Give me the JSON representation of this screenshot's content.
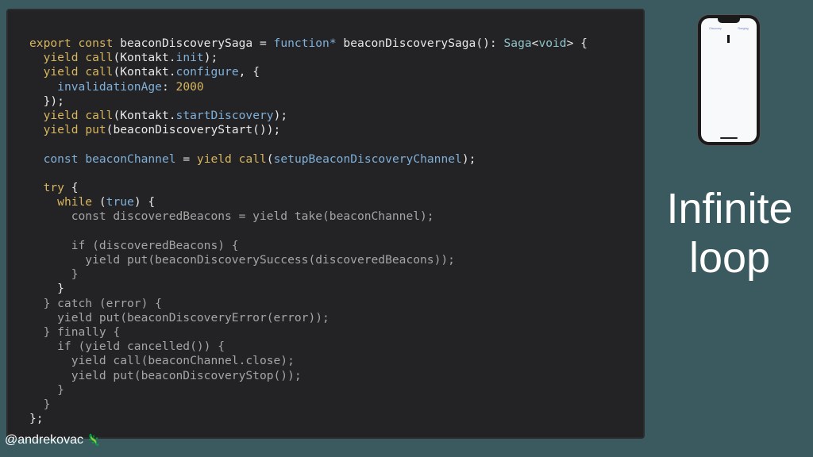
{
  "code_lines": [
    [
      [
        "kw",
        "export"
      ],
      [
        "pl",
        " "
      ],
      [
        "kw",
        "const"
      ],
      [
        "pl",
        " beaconDiscoverySaga = "
      ],
      [
        "fn",
        "function*"
      ],
      [
        "pl",
        " beaconDiscoverySaga(): "
      ],
      [
        "ty",
        "Saga"
      ],
      [
        "pl",
        "<"
      ],
      [
        "ty",
        "void"
      ],
      [
        "pl",
        "> {"
      ]
    ],
    [
      [
        "pl",
        "  "
      ],
      [
        "kw",
        "yield"
      ],
      [
        "pl",
        " "
      ],
      [
        "kw",
        "call"
      ],
      [
        "pl",
        "(Kontakt."
      ],
      [
        "fn",
        "init"
      ],
      [
        "pl",
        ");"
      ]
    ],
    [
      [
        "pl",
        "  "
      ],
      [
        "kw",
        "yield"
      ],
      [
        "pl",
        " "
      ],
      [
        "kw",
        "call"
      ],
      [
        "pl",
        "(Kontakt."
      ],
      [
        "fn",
        "configure"
      ],
      [
        "pl",
        ", {"
      ]
    ],
    [
      [
        "pl",
        "    "
      ],
      [
        "fn",
        "invalidationAge"
      ],
      [
        "pl",
        ": "
      ],
      [
        "num",
        "2000"
      ]
    ],
    [
      [
        "pl",
        "  });"
      ]
    ],
    [
      [
        "pl",
        "  "
      ],
      [
        "kw",
        "yield"
      ],
      [
        "pl",
        " "
      ],
      [
        "kw",
        "call"
      ],
      [
        "pl",
        "(Kontakt."
      ],
      [
        "fn",
        "startDiscovery"
      ],
      [
        "pl",
        ");"
      ]
    ],
    [
      [
        "pl",
        "  "
      ],
      [
        "kw",
        "yield"
      ],
      [
        "pl",
        " "
      ],
      [
        "kw",
        "put"
      ],
      [
        "pl",
        "(beaconDiscoveryStart());"
      ]
    ],
    [],
    [
      [
        "pl",
        "  "
      ],
      [
        "fn",
        "const"
      ],
      [
        "pl",
        " "
      ],
      [
        "fn",
        "beaconChannel"
      ],
      [
        "pl",
        " = "
      ],
      [
        "kw",
        "yield"
      ],
      [
        "pl",
        " "
      ],
      [
        "kw",
        "call"
      ],
      [
        "pl",
        "("
      ],
      [
        "fn",
        "setupBeaconDiscoveryChannel"
      ],
      [
        "pl",
        ");"
      ]
    ],
    [],
    [
      [
        "pl",
        "  "
      ],
      [
        "kw",
        "try"
      ],
      [
        "pl",
        " {"
      ]
    ],
    [
      [
        "pl",
        "    "
      ],
      [
        "kw",
        "while"
      ],
      [
        "pl",
        " ("
      ],
      [
        "fn",
        "true"
      ],
      [
        "pl",
        ") {"
      ]
    ],
    [
      [
        "dim",
        "      const discoveredBeacons = yield take(beaconChannel);"
      ]
    ],
    [],
    [
      [
        "dim",
        "      if (discoveredBeacons) {"
      ]
    ],
    [
      [
        "dim",
        "        yield put(beaconDiscoverySuccess(discoveredBeacons));"
      ]
    ],
    [
      [
        "dim",
        "      }"
      ]
    ],
    [
      [
        "pl",
        "    }"
      ]
    ],
    [
      [
        "dim",
        "  } catch (error) {"
      ]
    ],
    [
      [
        "dim",
        "    yield put(beaconDiscoveryError(error));"
      ]
    ],
    [
      [
        "dim",
        "  } finally {"
      ]
    ],
    [
      [
        "dim",
        "    if (yield cancelled()) {"
      ]
    ],
    [
      [
        "dim",
        "      yield call(beaconChannel.close);"
      ]
    ],
    [
      [
        "dim",
        "      yield put(beaconDiscoveryStop());"
      ]
    ],
    [
      [
        "dim",
        "    }"
      ]
    ],
    [
      [
        "dim",
        "  }"
      ]
    ],
    [
      [
        "pl",
        "};"
      ]
    ]
  ],
  "phone": {
    "tab_left": "Discovery",
    "tab_right": "Ranging"
  },
  "slide_title_line1": "Infinite",
  "slide_title_line2": "loop",
  "footer": {
    "handle": "@andrekovac",
    "emoji": "🦎"
  },
  "colors": {
    "background": "#3a5a5f",
    "code_bg": "#232325",
    "keyword": "#d8b65e",
    "function": "#7fb0d9",
    "type": "#8ec3c8",
    "dimmed": "#a5a5a5"
  }
}
